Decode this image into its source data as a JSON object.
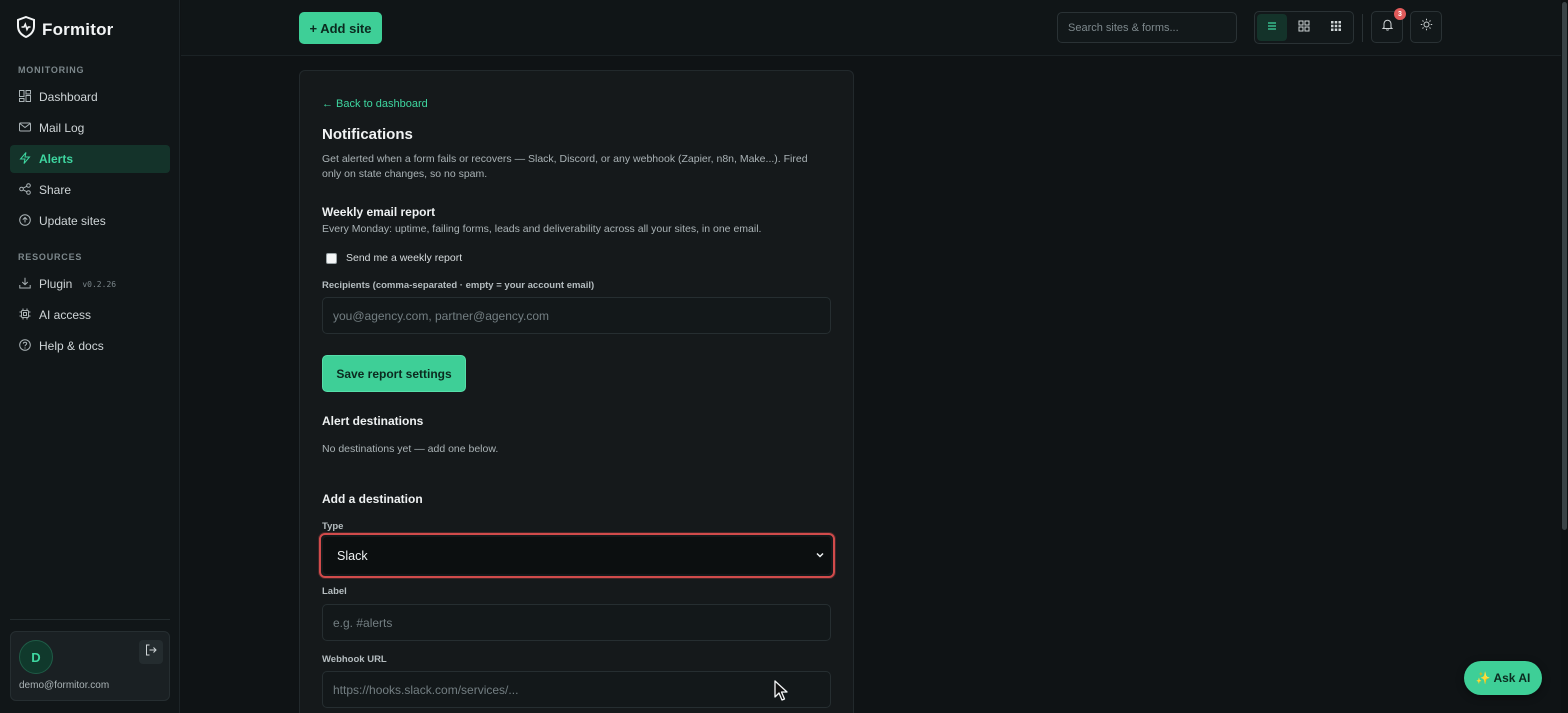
{
  "app": {
    "name": "Formitor"
  },
  "sidebar": {
    "sections": [
      {
        "label": "MONITORING"
      },
      {
        "label": "RESOURCES"
      }
    ],
    "items": [
      {
        "label": "Dashboard",
        "icon": "dashboard-icon"
      },
      {
        "label": "Mail Log",
        "icon": "mail-icon"
      },
      {
        "label": "Alerts",
        "icon": "lightning-icon",
        "active": true
      },
      {
        "label": "Share",
        "icon": "share-icon"
      },
      {
        "label": "Update sites",
        "icon": "update-icon"
      },
      {
        "label": "Plugin",
        "icon": "download-icon",
        "version": "v0.2.26"
      },
      {
        "label": "AI access",
        "icon": "chip-icon"
      },
      {
        "label": "Help & docs",
        "icon": "help-icon"
      }
    ],
    "user": {
      "initial": "D",
      "email": "demo@formitor.com"
    }
  },
  "topbar": {
    "add_site_label": "+ Add site",
    "search_placeholder": "Search sites & forms...",
    "notification_count": "3"
  },
  "content": {
    "back_link": "← Back to dashboard",
    "title": "Notifications",
    "description": "Get alerted when a form fails or recovers — Slack, Discord, or any webhook (Zapier, n8n, Make...). Fired only on state changes, so no spam.",
    "weekly_report": {
      "title": "Weekly email report",
      "description": "Every Monday: uptime, failing forms, leads and deliverability across all your sites, in one email.",
      "checkbox_label": "Send me a weekly report",
      "checked": false,
      "recipients_label": "Recipients (comma-separated · empty = your account email)",
      "recipients_placeholder": "you@agency.com, partner@agency.com",
      "save_label": "Save report settings"
    },
    "alert_destinations": {
      "title": "Alert destinations",
      "empty_text": "No destinations yet — add one below."
    },
    "add_destination": {
      "title": "Add a destination",
      "type_label": "Type",
      "type_value": "Slack",
      "label_label": "Label",
      "label_placeholder": "e.g. #alerts",
      "webhook_label": "Webhook URL",
      "webhook_placeholder": "https://hooks.slack.com/services/..."
    }
  },
  "ask_ai_label": "✨ Ask AI",
  "colors": {
    "accent": "#3ecf97",
    "accent_text": "#3ed6a0",
    "background": "#0f1315",
    "card": "#15191b",
    "error_outline": "#d14b4b"
  }
}
